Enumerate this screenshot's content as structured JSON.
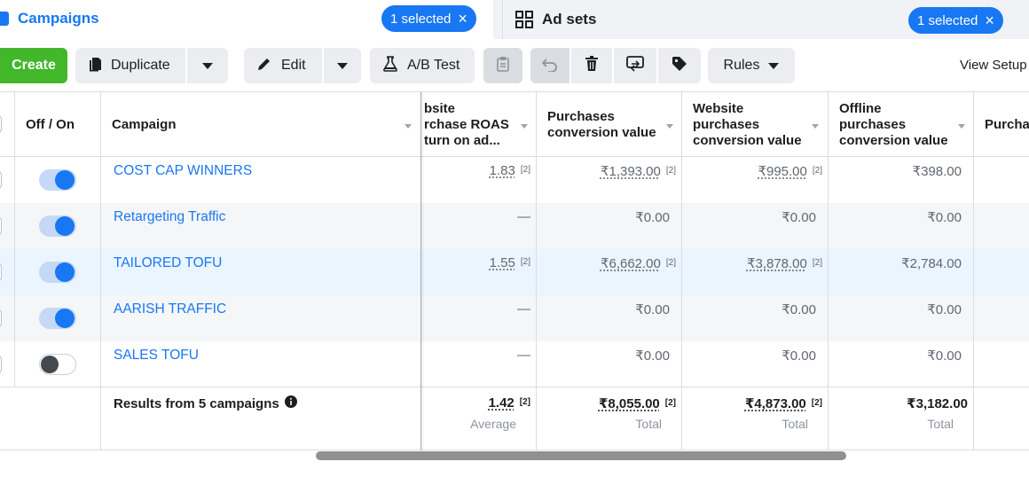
{
  "tabs": {
    "campaigns": {
      "label": "Campaigns",
      "selected_label": "1 selected"
    },
    "adsets": {
      "label": "Ad sets",
      "selected_label": "1 selected"
    }
  },
  "toolbar": {
    "create": "Create",
    "duplicate": "Duplicate",
    "edit": "Edit",
    "ab_test": "A/B Test",
    "rules": "Rules",
    "view_setup": "View Setup"
  },
  "table": {
    "headers": {
      "off_on": "Off / On",
      "campaign": "Campaign",
      "website_roas": [
        "bsite",
        "rchase ROAS",
        "turn on ad..."
      ],
      "purchases_conv_value": [
        "Purchases",
        "conversion value"
      ],
      "website_purchases_conv_value": [
        "Website",
        "purchases",
        "conversion value"
      ],
      "offline_purchases_conv_value": [
        "Offline",
        "purchases",
        "conversion value"
      ],
      "purchases_partial": "Purcha"
    },
    "rows": [
      {
        "name": "COST CAP WINNERS",
        "on": true,
        "roas": "1.83",
        "roas_note": "[2]",
        "purchases_value": "₹1,393.00",
        "purchases_note": "[2]",
        "website_value": "₹995.00",
        "website_note": "[2]",
        "offline_value": "₹398.00"
      },
      {
        "name": "Retargeting Traffic",
        "on": true,
        "roas": "—",
        "roas_note": "",
        "purchases_value": "₹0.00",
        "purchases_note": "",
        "website_value": "₹0.00",
        "website_note": "",
        "offline_value": "₹0.00"
      },
      {
        "name": "TAILORED TOFU",
        "on": true,
        "roas": "1.55",
        "roas_note": "[2]",
        "purchases_value": "₹6,662.00",
        "purchases_note": "[2]",
        "website_value": "₹3,878.00",
        "website_note": "[2]",
        "offline_value": "₹2,784.00"
      },
      {
        "name": "AARISH TRAFFIC",
        "on": true,
        "roas": "—",
        "roas_note": "",
        "purchases_value": "₹0.00",
        "purchases_note": "",
        "website_value": "₹0.00",
        "website_note": "",
        "offline_value": "₹0.00"
      },
      {
        "name": "SALES TOFU",
        "on": false,
        "roas": "—",
        "roas_note": "",
        "purchases_value": "₹0.00",
        "purchases_note": "",
        "website_value": "₹0.00",
        "website_note": "",
        "offline_value": "₹0.00"
      }
    ],
    "summary": {
      "label": "Results from 5 campaigns",
      "roas": "1.42",
      "roas_note": "[2]",
      "roas_sub": "Average",
      "purchases_value": "₹8,055.00",
      "purchases_note": "[2]",
      "purchases_sub": "Total",
      "website_value": "₹4,873.00",
      "website_note": "[2]",
      "website_sub": "Total",
      "offline_value": "₹3,182.00",
      "offline_sub": "Total"
    }
  },
  "colors": {
    "brand_blue": "#1877f2",
    "create_green": "#42b72a",
    "row_alt": "#f5f6f7",
    "row_selected": "#ebf5ff"
  },
  "icons": [
    "campaigns-icon",
    "adsets-grid-icon",
    "close-icon",
    "duplicate-icon",
    "pencil-icon",
    "flask-icon",
    "clipboard-icon",
    "undo-icon",
    "trash-icon",
    "move-icon",
    "tag-icon",
    "chevron-down-icon",
    "info-icon"
  ]
}
